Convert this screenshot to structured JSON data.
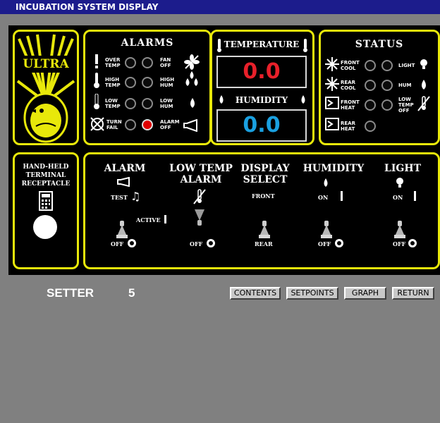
{
  "window": {
    "title": "INCUBATION SYSTEM DISPLAY"
  },
  "logo": {
    "text": "ULTRA"
  },
  "alarms": {
    "title": "ALARMS",
    "rows": [
      {
        "left": "OVER TEMP",
        "right": "FAN OFF"
      },
      {
        "left": "HIGH TEMP",
        "right": "HIGH HUM"
      },
      {
        "left": "LOW TEMP",
        "right": "LOW HUM"
      },
      {
        "left": "TURN FAIL",
        "right": "ALARM OFF"
      }
    ]
  },
  "readout": {
    "temperature_label": "TEMPERATURE",
    "temperature_value": "0.0",
    "humidity_label": "HUMIDITY",
    "humidity_value": "0.0",
    "temperature_color": "#e8202a",
    "humidity_color": "#1aa0e0"
  },
  "status": {
    "title": "STATUS",
    "rows": [
      {
        "left": "FRONT COOL",
        "right": "LIGHT"
      },
      {
        "left": "REAR COOL",
        "right": "HUM"
      },
      {
        "left": "FRONT HEAT",
        "right": "LOW TEMP OFF"
      },
      {
        "left": "REAR HEAT",
        "right": ""
      }
    ]
  },
  "terminal": {
    "label": "HAND-HELD TERMINAL RECEPTACLE"
  },
  "controls": {
    "alarm": {
      "title": "ALARM",
      "test": "TEST",
      "active": "ACTIVE",
      "off": "OFF"
    },
    "low_temp_alarm": {
      "title": "LOW TEMP ALARM",
      "off": "OFF"
    },
    "display_select": {
      "title": "DISPLAY SELECT",
      "front": "FRONT",
      "rear": "REAR"
    },
    "humidity": {
      "title": "HUMIDITY",
      "on": "ON",
      "off": "OFF"
    },
    "light": {
      "title": "LIGHT",
      "on": "ON",
      "off": "OFF"
    }
  },
  "footer": {
    "setter_label": "SETTER",
    "setter_number": "5",
    "buttons": [
      "CONTENTS",
      "SETPOINTS",
      "GRAPH",
      "RETURN"
    ]
  },
  "colors": {
    "panel_border": "#e8e80a",
    "led_active": "#e00000",
    "title_bar": "#1c1c8c"
  }
}
